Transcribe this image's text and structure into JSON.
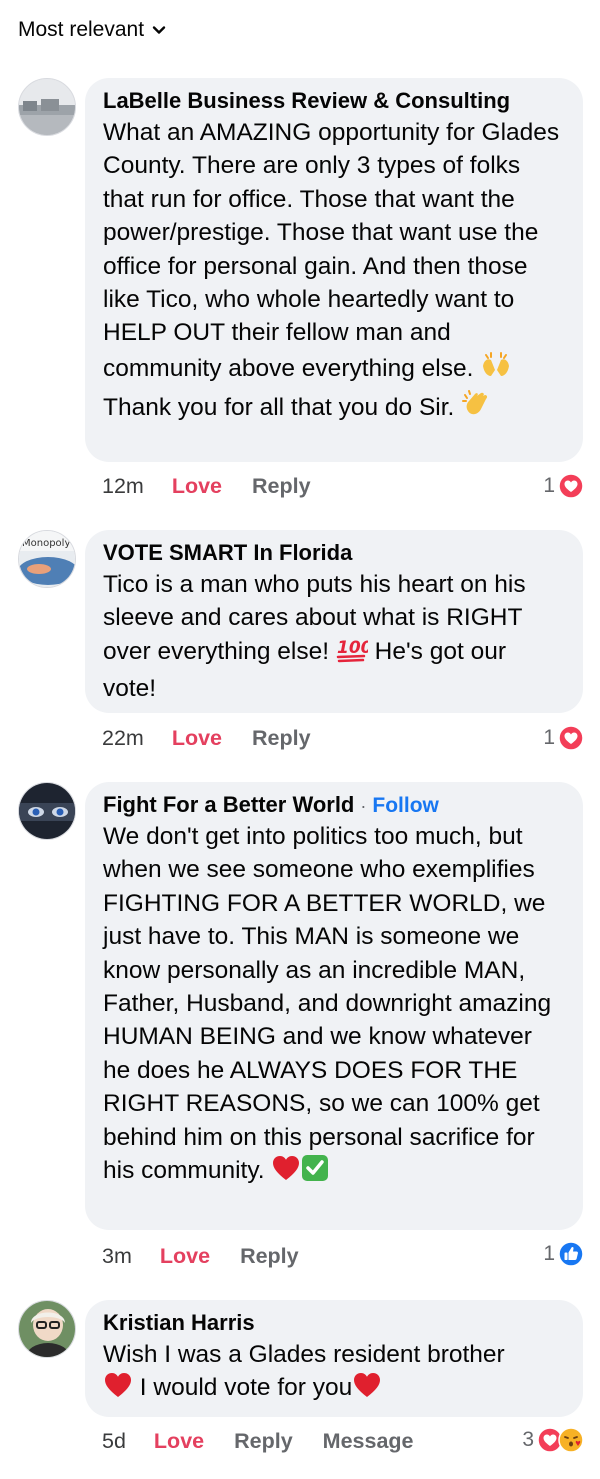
{
  "sort": {
    "label": "Most relevant"
  },
  "colors": {
    "love": "#e4405f",
    "like": "#1877f2",
    "bubble": "#f0f2f5",
    "meta": "#65676b"
  },
  "comments": [
    {
      "author": "LaBelle Business Review & Consulting",
      "text_1": "What an AMAZING opportunity for Glades County.  There are only 3 types of folks that run for office.  Those that want the power/prestige.  Those that want use the office for personal gain. And then those like Tico, who whole heartedly want to HELP OUT their fellow man and community above everything else. ",
      "text_2": " Thank you for all that you do Sir. ",
      "time": "12m",
      "love": "Love",
      "reply": "Reply",
      "reaction_count": "1",
      "reaction_icon": "heart-icon"
    },
    {
      "author": "VOTE SMART In Florida",
      "avatar_text": "Monopoly",
      "text_1": "Tico is a man who puts his heart on his sleeve and cares about what is RIGHT over everything else! ",
      "text_2": " He's got our vote!",
      "time": "22m",
      "love": "Love",
      "reply": "Reply",
      "reaction_count": "1",
      "reaction_icon": "heart-icon"
    },
    {
      "author": "Fight For a Better World",
      "follow": "Follow",
      "text_1": "We don't get into politics too much, but when we see someone who exemplifies FIGHTING FOR A BETTER WORLD, we just have to.  This MAN is someone we know personally as an incredible MAN, Father, Husband, and downright amazing HUMAN BEING and we know whatever he does he ALWAYS DOES FOR THE RIGHT REASONS, so we can 100% get behind him on this personal sacrifice for his community. ",
      "time": "3m",
      "love": "Love",
      "reply": "Reply",
      "reaction_count": "1",
      "reaction_icon": "like-icon"
    },
    {
      "author": "Kristian Harris",
      "text_1": "Wish I was a Glades resident brother",
      "text_2": " I would vote for you",
      "time": "5d",
      "love": "Love",
      "reply": "Reply",
      "message": "Message",
      "reaction_count": "3",
      "reaction_icon": "heart-and-kiss-icons"
    }
  ]
}
